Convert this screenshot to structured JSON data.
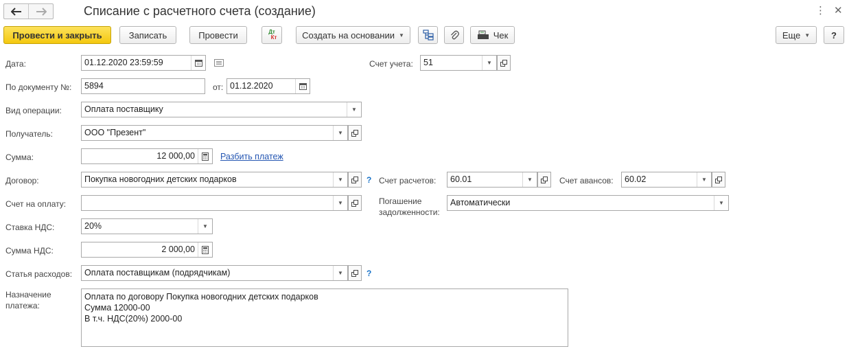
{
  "window": {
    "title": "Списание с расчетного счета (создание)",
    "menu_icon": "more-vertical-icon",
    "close_icon": "close-icon"
  },
  "toolbar": {
    "post_close": "Провести и закрыть",
    "save": "Записать",
    "post": "Провести",
    "dt_kt_top": "Дт",
    "dt_kt_bottom": "Кт",
    "create_based": "Создать на основании",
    "receipt": "Чек",
    "more": "Еще",
    "help": "?"
  },
  "form": {
    "date": {
      "label": "Дата:",
      "value": "01.12.2020 23:59:59"
    },
    "account": {
      "label": "Счет учета:",
      "value": "51"
    },
    "doc_number": {
      "label": "По документу №:",
      "value": "5894"
    },
    "doc_date": {
      "label": "от:",
      "value": "01.12.2020"
    },
    "operation": {
      "label": "Вид операции:",
      "value": "Оплата поставщику"
    },
    "recipient": {
      "label": "Получатель:",
      "value": "ООО \"Презент\""
    },
    "amount": {
      "label": "Сумма:",
      "value": "12 000,00"
    },
    "split_payment": "Разбить платеж",
    "contract": {
      "label": "Договор:",
      "value": "Покупка новогодних детских подарков",
      "help": "?"
    },
    "settlement_account": {
      "label": "Счет расчетов:",
      "value": "60.01"
    },
    "advance_account": {
      "label": "Счет авансов:",
      "value": "60.02"
    },
    "invoice": {
      "label": "Счет на оплату:",
      "value": ""
    },
    "debt_repayment": {
      "label_line1": "Погашение",
      "label_line2": "задолженности:",
      "value": "Автоматически"
    },
    "vat_rate": {
      "label": "Ставка НДС:",
      "value": "20%"
    },
    "vat_amount": {
      "label": "Сумма НДС:",
      "value": "2 000,00"
    },
    "expense_item": {
      "label": "Статья расходов:",
      "value": "Оплата поставщикам (подрядчикам)",
      "help": "?"
    },
    "purpose": {
      "label_line1": "Назначение",
      "label_line2": "платежа:",
      "lines": [
        "Оплата по договору Покупка новогодних детских подарков",
        "Сумма 12000-00",
        "В т.ч. НДС(20%) 2000-00"
      ]
    }
  }
}
